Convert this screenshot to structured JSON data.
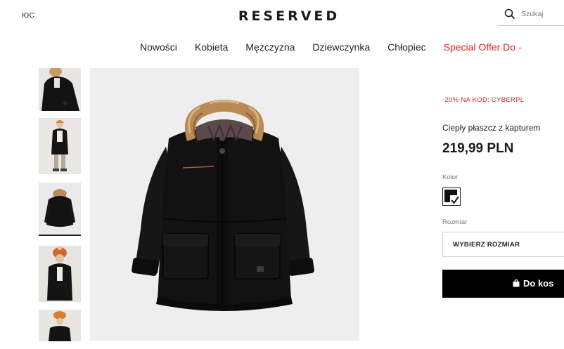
{
  "header": {
    "promo_left": "ЮC",
    "logo": "RESERVED",
    "search_placeholder": "Szukaj"
  },
  "nav": {
    "items": [
      "Nowości",
      "Kobieta",
      "Mężczyzna",
      "Dziewczynka",
      "Chłopiec"
    ],
    "special": "Special Offer Do -"
  },
  "product": {
    "promo_code": "-20% NA KOD: CYBERPL",
    "title": "Ciepły płaszcz z kapturem",
    "price": "219,99 PLN",
    "color_label": "Kolor",
    "size_label": "Rozmiar",
    "size_select": "WYBIERZ ROZMIAR",
    "cart_button": "Do kos"
  },
  "colors": {
    "accent_red": "#e0262b",
    "button_black": "#000000",
    "jacket": "#121212",
    "fur": "#b98a55"
  }
}
